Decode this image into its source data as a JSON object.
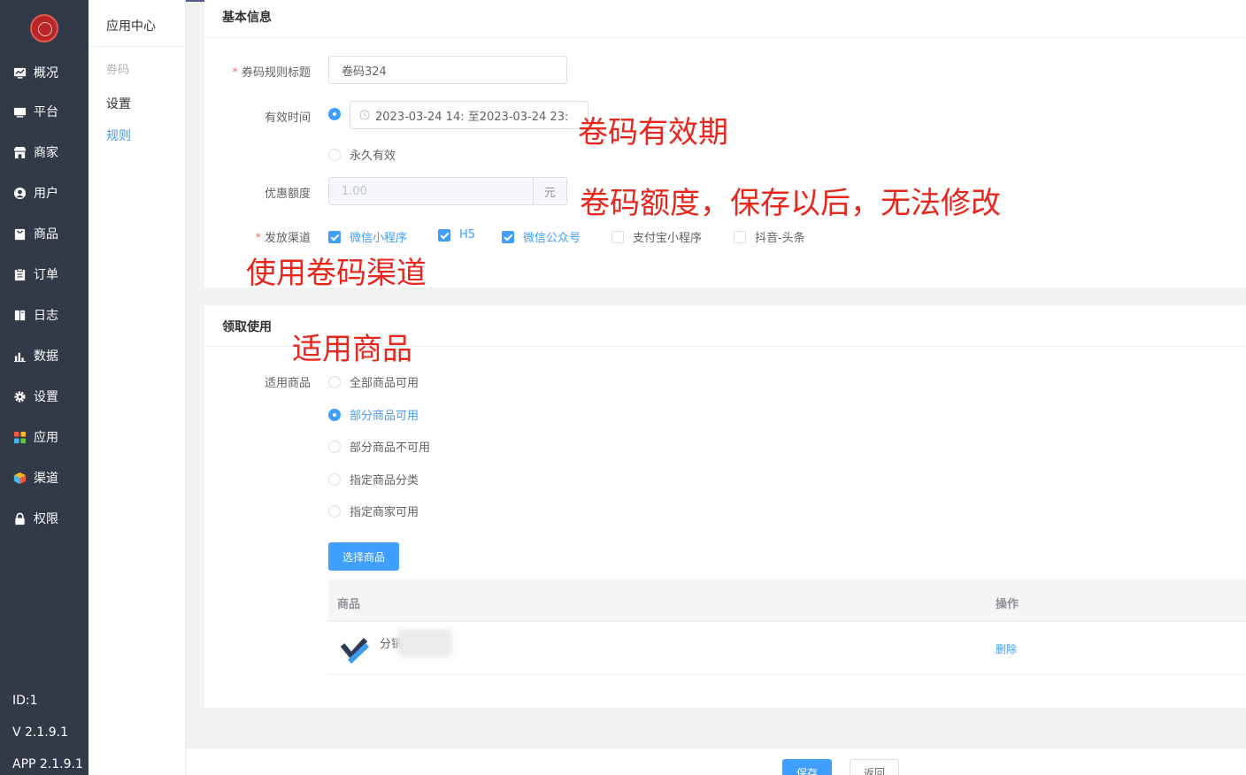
{
  "sidebar": {
    "items": [
      {
        "label": "概况",
        "icon": "chart-monitor-icon"
      },
      {
        "label": "平台",
        "icon": "monitor-icon"
      },
      {
        "label": "商家",
        "icon": "store-icon"
      },
      {
        "label": "用户",
        "icon": "user-icon"
      },
      {
        "label": "商品",
        "icon": "bag-icon"
      },
      {
        "label": "订单",
        "icon": "clipboard-icon"
      },
      {
        "label": "日志",
        "icon": "book-icon"
      },
      {
        "label": "数据",
        "icon": "bar-chart-icon"
      },
      {
        "label": "设置",
        "icon": "gear-icon"
      },
      {
        "label": "应用",
        "icon": "apps-grid-icon"
      },
      {
        "label": "渠道",
        "icon": "cube-icon"
      },
      {
        "label": "权限",
        "icon": "lock-icon"
      }
    ],
    "id_text": "ID:1",
    "version": "V 2.1.9.1",
    "app_version": "APP 2.1.9.1"
  },
  "submenu": {
    "title": "应用中心",
    "group": "券码",
    "items": [
      "设置",
      "规则"
    ],
    "active": "规则"
  },
  "basic": {
    "section_title": "基本信息",
    "title_label": "券码规则标题",
    "title_value": "卷码324",
    "valid_label": "有效时间",
    "date_range": "2023-03-24 14: 至2023-03-24 23:",
    "permanent_label": "永久有效",
    "discount_label": "优惠额度",
    "discount_placeholder": "1.00",
    "discount_unit": "元",
    "channel_label": "发放渠道",
    "channels": [
      {
        "label": "微信小程序",
        "checked": true
      },
      {
        "label": "H5",
        "checked": true
      },
      {
        "label": "微信公众号",
        "checked": true
      },
      {
        "label": "支付宝小程序",
        "checked": false
      },
      {
        "label": "抖音-头条",
        "checked": false
      }
    ]
  },
  "usage": {
    "section_title": "领取使用",
    "goods_label": "适用商品",
    "options": [
      {
        "label": "全部商品可用",
        "selected": false
      },
      {
        "label": "部分商品可用",
        "selected": true
      },
      {
        "label": "部分商品不可用",
        "selected": false
      },
      {
        "label": "指定商品分类",
        "selected": false
      },
      {
        "label": "指定商家可用",
        "selected": false
      }
    ],
    "select_button": "选择商品",
    "table": {
      "headers": {
        "goods": "商品",
        "action": "操作"
      },
      "rows": [
        {
          "name": "分销",
          "action": "删除"
        }
      ]
    }
  },
  "annotations": {
    "validity": "卷码有效期",
    "amount": "卷码额度，保存以后，无法修改",
    "channel": "使用卷码渠道",
    "goods": "适用商品"
  },
  "footer": {
    "save": "保存",
    "back": "返回"
  },
  "colors": {
    "sidebar_bg": "#323a47",
    "primary": "#409eff",
    "annotation": "#e8261c",
    "required": "#f56c6c"
  }
}
